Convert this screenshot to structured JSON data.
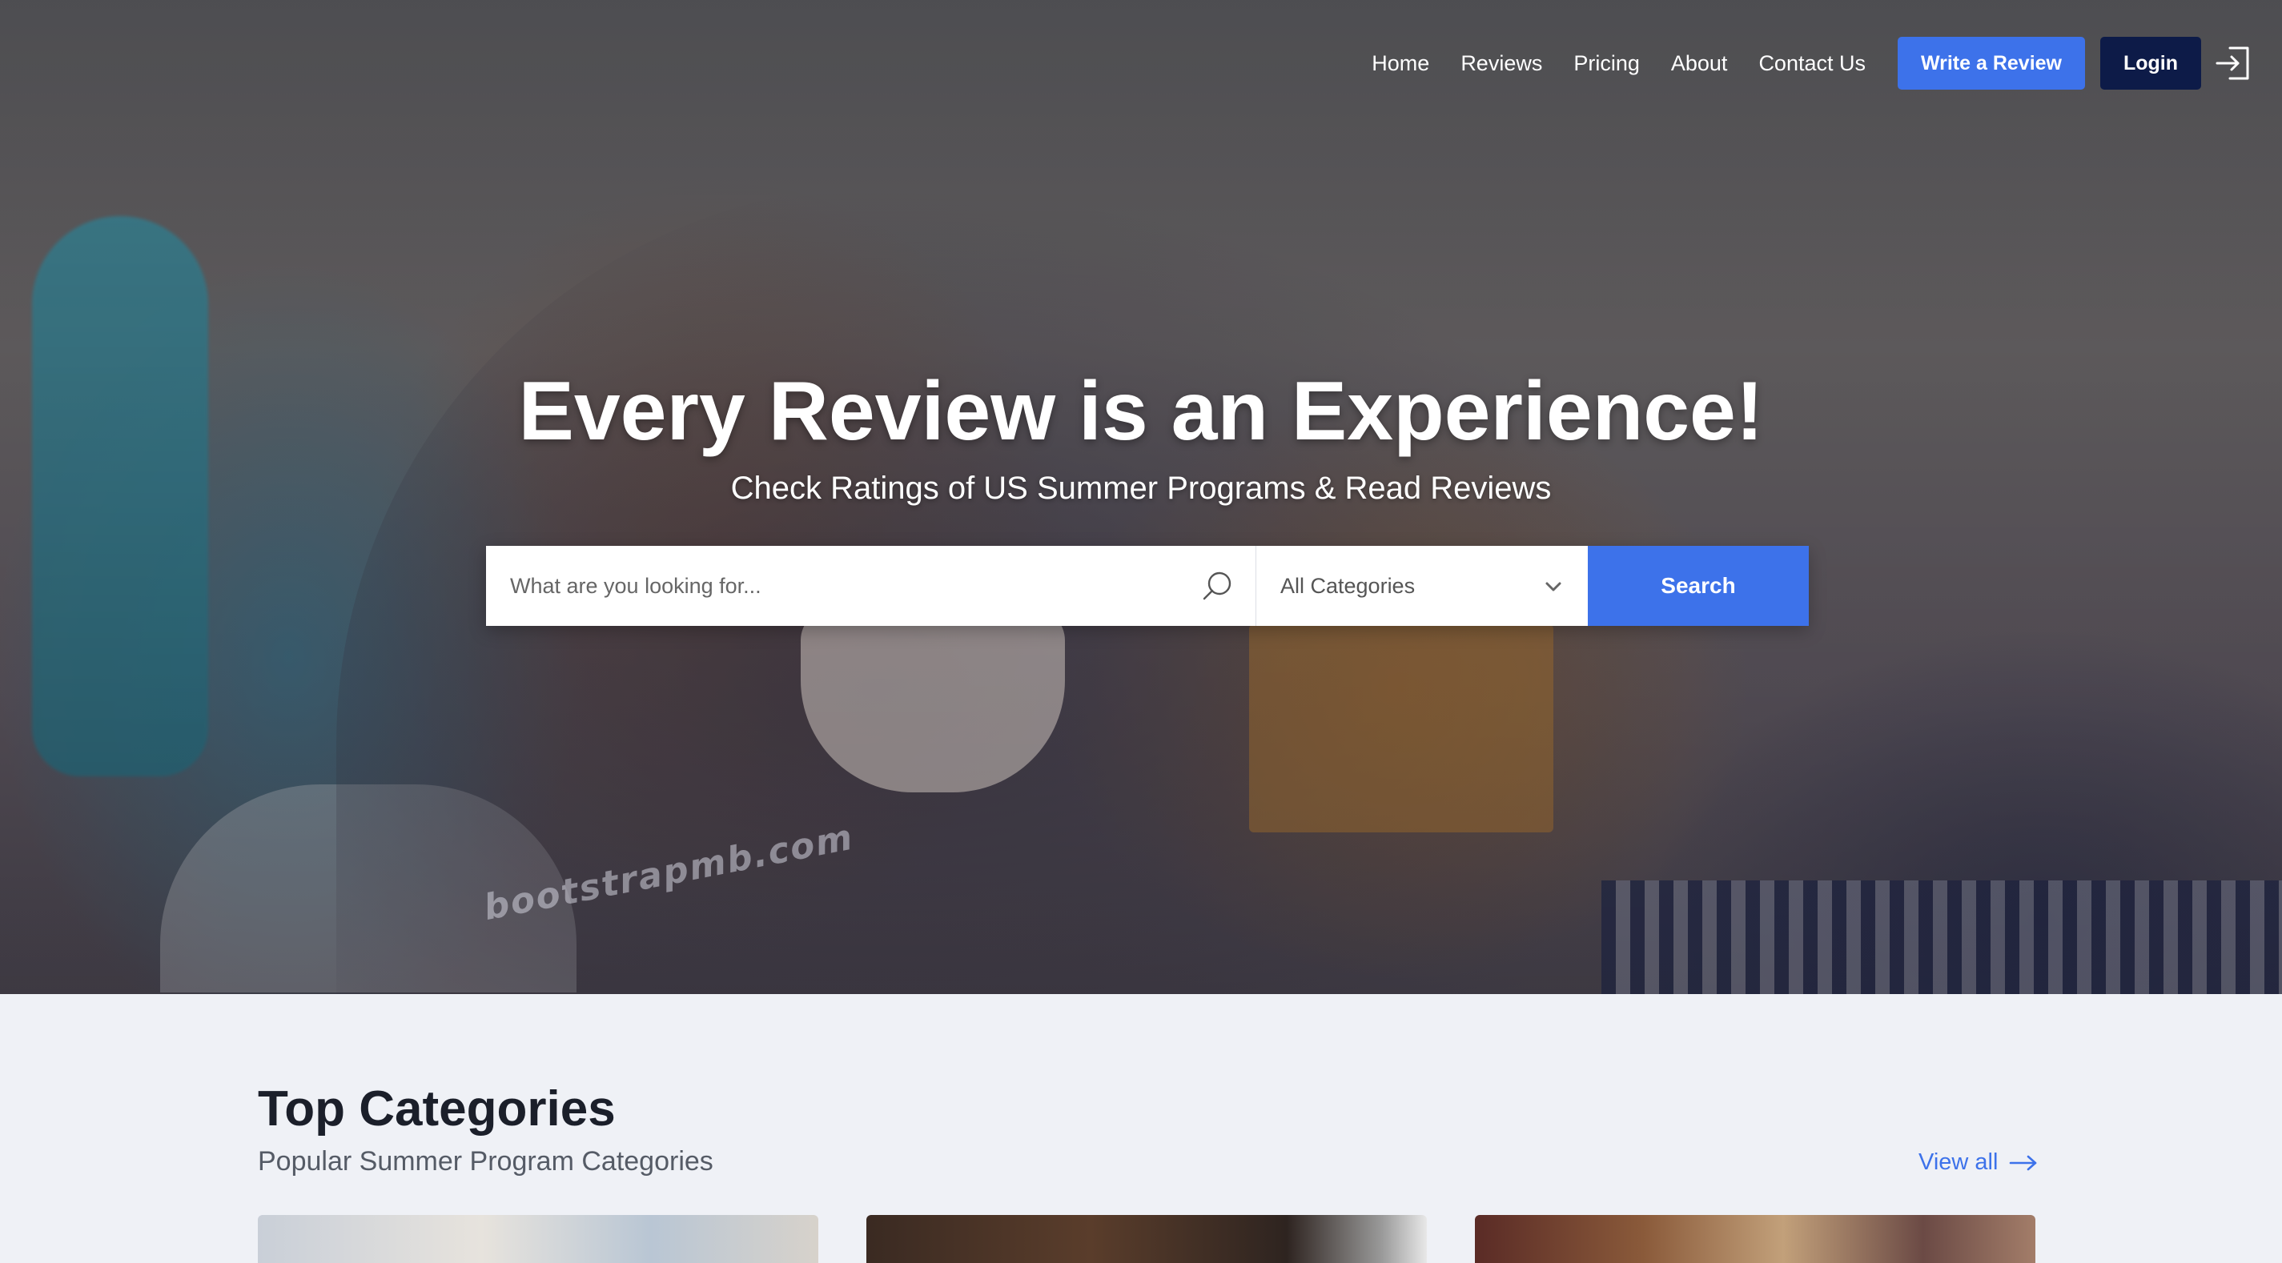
{
  "nav": {
    "links": [
      "Home",
      "Reviews",
      "Pricing",
      "About",
      "Contact Us"
    ],
    "write_review": "Write a Review",
    "login": "Login",
    "login_icon": "sign-in-icon"
  },
  "hero": {
    "title": "Every Review is an Experience!",
    "subtitle": "Check Ratings of US Summer Programs & Read Reviews",
    "watermark": "bootstrapmb.com"
  },
  "search": {
    "placeholder": "What are you looking for...",
    "value": "",
    "search_icon": "search-icon",
    "category_selected": "All Categories",
    "category_icon": "chevron-down-icon",
    "button_label": "Search"
  },
  "categories_section": {
    "title": "Top Categories",
    "subtitle": "Popular Summer Program Categories",
    "view_all": "View all",
    "view_all_icon": "arrow-right-icon"
  },
  "colors": {
    "accent": "#3d72ea",
    "login_bg": "#0d1b48",
    "page_bg": "#eff1f6",
    "heading": "#1b1f2a"
  }
}
